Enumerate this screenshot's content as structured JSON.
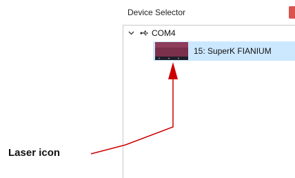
{
  "window": {
    "title": "Device Selector",
    "close_color": "#d9534f"
  },
  "tree": {
    "port": {
      "label": "COM4",
      "expanded": true,
      "icon": "usb-icon"
    },
    "devices": [
      {
        "label": "15: SuperK FIANIUM",
        "icon": "laser-device-icon",
        "selected": true
      }
    ]
  },
  "annotation": {
    "label": "Laser icon",
    "color": "#cc0000"
  }
}
